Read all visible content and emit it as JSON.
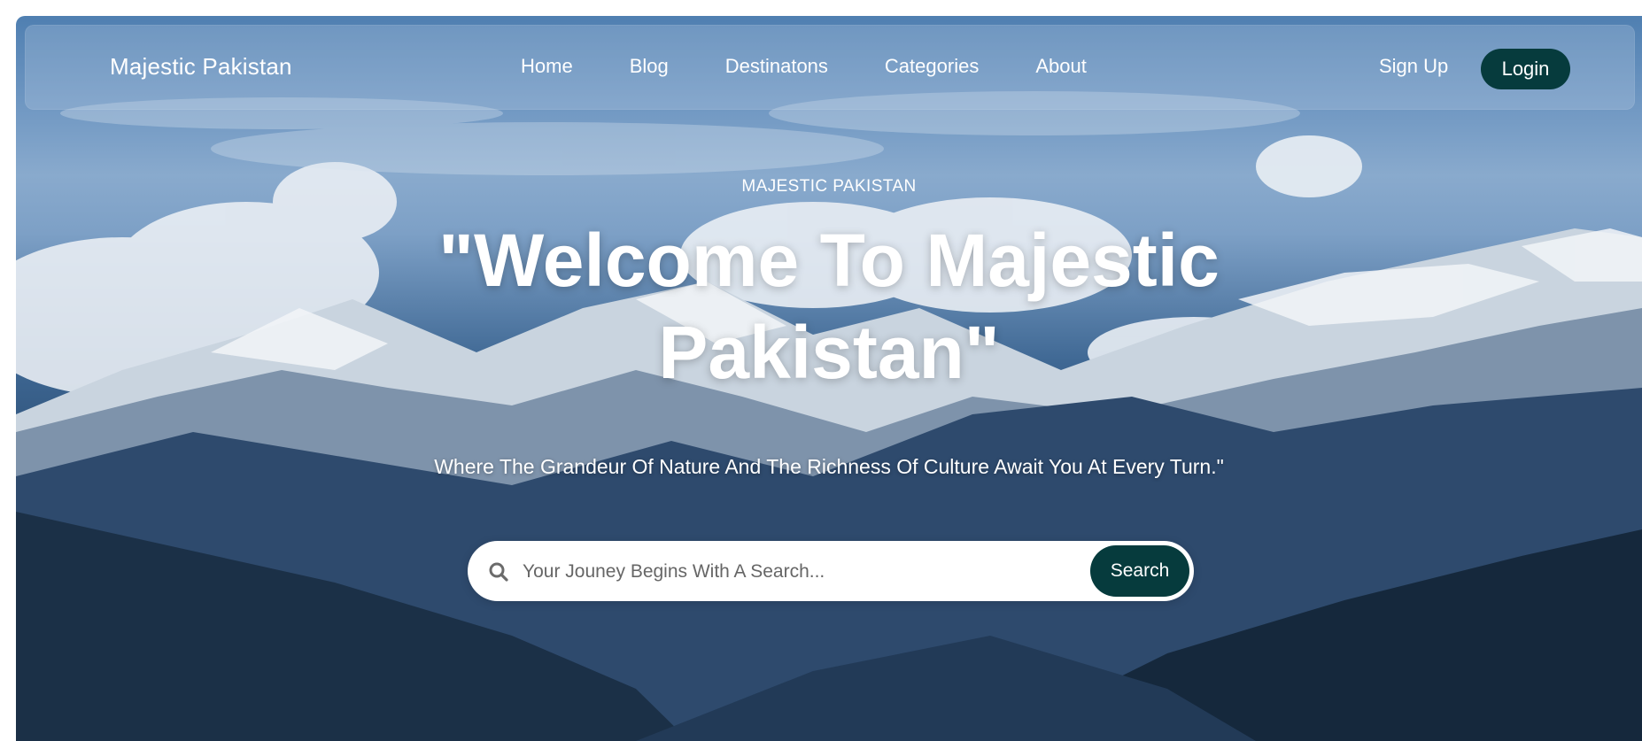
{
  "nav": {
    "brand": "Majestic Pakistan",
    "links": [
      "Home",
      "Blog",
      "Destinatons",
      "Categories",
      "About"
    ],
    "signup_label": "Sign Up",
    "login_label": "Login",
    "login_color": "#063b3d"
  },
  "hero": {
    "eyebrow": "MAJESTIC PAKISTAN",
    "headline": "\"Welcome To Majestic Pakistan\"",
    "subtitle": "Where The Grandeur Of Nature And The Richness Of Culture Await You At Every Turn.\""
  },
  "search": {
    "placeholder": "Your Jouney Begins With A Search...",
    "value": "",
    "button_label": "Search",
    "icon": "search-icon"
  }
}
